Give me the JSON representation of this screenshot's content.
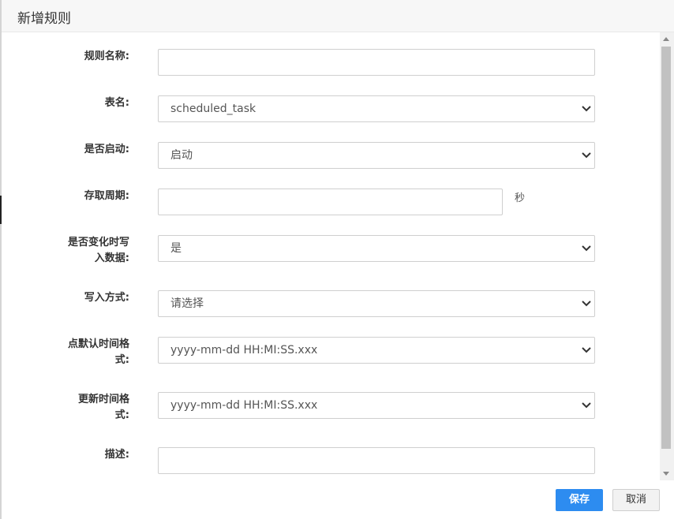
{
  "dialog": {
    "title": "新增规则"
  },
  "form": {
    "rule_name": {
      "label": "规则名称:",
      "value": ""
    },
    "table_name": {
      "label": "表名:",
      "value": "scheduled_task"
    },
    "enabled": {
      "label": "是否启动:",
      "value": "启动"
    },
    "access_period": {
      "label": "存取周期:",
      "value": "",
      "unit": "秒"
    },
    "write_on_change": {
      "label_line1": "是否变化时写",
      "label_line2": "入数据:",
      "value": "是"
    },
    "write_mode": {
      "label": "写入方式:",
      "value": "请选择"
    },
    "point_default_time_format": {
      "label_line1": "点默认时间格",
      "label_line2": "式:",
      "value": "yyyy-mm-dd HH:MI:SS.xxx"
    },
    "update_time_format": {
      "label_line1": "更新时间格",
      "label_line2": "式:",
      "value": "yyyy-mm-dd HH:MI:SS.xxx"
    },
    "description": {
      "label": "描述:",
      "value": ""
    }
  },
  "footer": {
    "save_label": "保存",
    "cancel_label": "取消"
  },
  "colors": {
    "primary": "#2d8cf0",
    "header_bg": "#f7f7f7"
  }
}
